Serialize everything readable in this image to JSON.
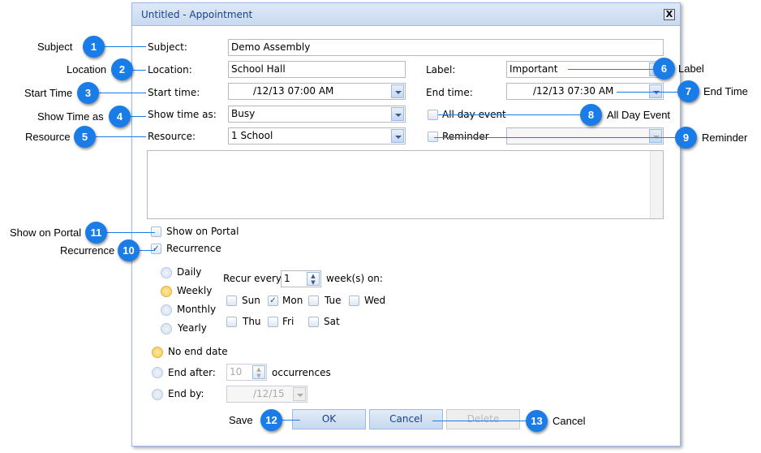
{
  "dialog": {
    "title": "Untitled - Appointment",
    "close": "X"
  },
  "form": {
    "subject_label": "Subject:",
    "subject_value": "Demo Assembly",
    "location_label": "Location:",
    "location_value": "School Hall",
    "label_label": "Label:",
    "label_value": "Important",
    "start_label": "Start time:",
    "start_value": "/12/13 07:00 AM",
    "end_label": "End time:",
    "end_value": "/12/13 07:30 AM",
    "showas_label": "Show time as:",
    "showas_value": "Busy",
    "allday_label": "All day event",
    "resource_label": "Resource:",
    "resource_value": "1 School",
    "reminder_label": "Reminder",
    "reminder_value": "",
    "description": "",
    "portal_label": "Show on Portal",
    "recurrence_label": "Recurrence",
    "recurrence_checked": true
  },
  "recurrence": {
    "types": [
      {
        "label": "Daily",
        "selected": false
      },
      {
        "label": "Weekly",
        "selected": true
      },
      {
        "label": "Monthly",
        "selected": false
      },
      {
        "label": "Yearly",
        "selected": false
      }
    ],
    "recur_every_label": "Recur every",
    "recur_every_value": "1",
    "unit_label": "week(s) on:",
    "days": [
      {
        "label": "Sun",
        "checked": false
      },
      {
        "label": "Mon",
        "checked": true
      },
      {
        "label": "Tue",
        "checked": false
      },
      {
        "label": "Wed",
        "checked": false
      },
      {
        "label": "Thu",
        "checked": false
      },
      {
        "label": "Fri",
        "checked": false
      },
      {
        "label": "Sat",
        "checked": false
      }
    ],
    "no_end_label": "No end date",
    "end_after_label": "End after:",
    "end_after_value": "10",
    "occurrences_label": "occurrences",
    "end_by_label": "End by:",
    "end_by_value": "/12/15",
    "end_selected": "No end date"
  },
  "buttons": {
    "ok": "OK",
    "cancel": "Cancel",
    "delete": "Delete"
  },
  "callouts": [
    {
      "n": "1",
      "text": "Subject"
    },
    {
      "n": "2",
      "text": "Location"
    },
    {
      "n": "3",
      "text": "Start Time"
    },
    {
      "n": "4",
      "text": "Show Time as"
    },
    {
      "n": "5",
      "text": "Resource"
    },
    {
      "n": "6",
      "text": "Label"
    },
    {
      "n": "7",
      "text": "End Time"
    },
    {
      "n": "8",
      "text": "All Day Event"
    },
    {
      "n": "9",
      "text": "Reminder"
    },
    {
      "n": "10",
      "text": "Recurrence"
    },
    {
      "n": "11",
      "text": "Show on Portal"
    },
    {
      "n": "12",
      "text": "Save"
    },
    {
      "n": "13",
      "text": "Cancel"
    }
  ],
  "colors": {
    "callout": "#1a7ce6",
    "title_text": "#15428b",
    "border": "#99bbe8"
  }
}
